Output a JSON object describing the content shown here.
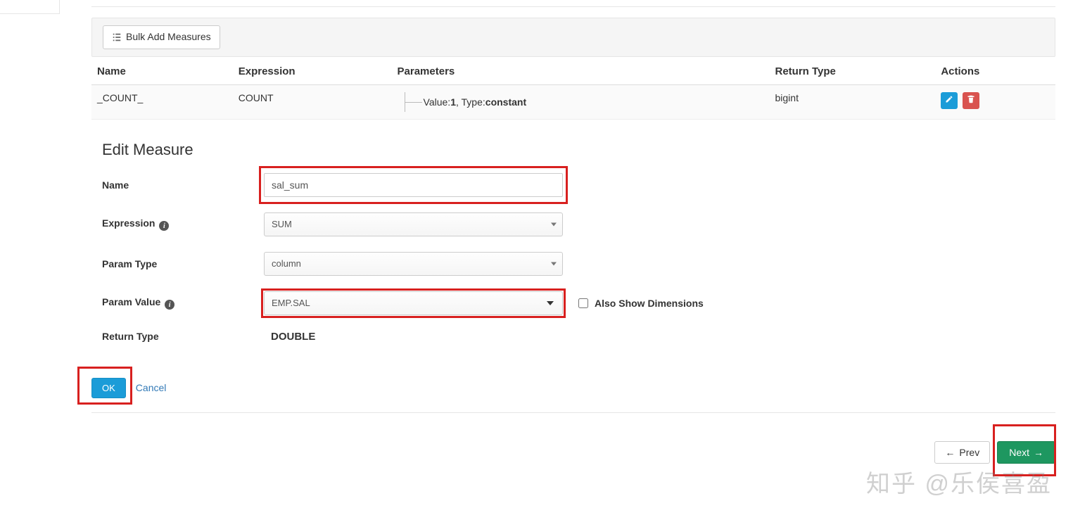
{
  "toolbar": {
    "bulk_add_label": "Bulk Add Measures"
  },
  "table": {
    "headers": {
      "name": "Name",
      "expression": "Expression",
      "parameters": "Parameters",
      "return_type": "Return Type",
      "actions": "Actions"
    },
    "rows": [
      {
        "name": "_COUNT_",
        "expression": "COUNT",
        "param_value_label": "Value:",
        "param_value": "1",
        "param_type_label": ", Type:",
        "param_type": "constant",
        "return_type": "bigint"
      }
    ]
  },
  "edit": {
    "title": "Edit Measure",
    "labels": {
      "name": "Name",
      "expression": "Expression",
      "param_type": "Param Type",
      "param_value": "Param Value",
      "return_type": "Return Type",
      "also_show_dimensions": "Also Show Dimensions"
    },
    "values": {
      "name": "sal_sum",
      "expression": "SUM",
      "param_type": "column",
      "param_value": "EMP.SAL",
      "return_type": "DOUBLE",
      "also_show_dimensions_checked": false
    },
    "buttons": {
      "ok": "OK",
      "cancel": "Cancel"
    }
  },
  "nav": {
    "prev": "Prev",
    "next": "Next"
  },
  "watermark": "知乎 @乐侯喜盈"
}
